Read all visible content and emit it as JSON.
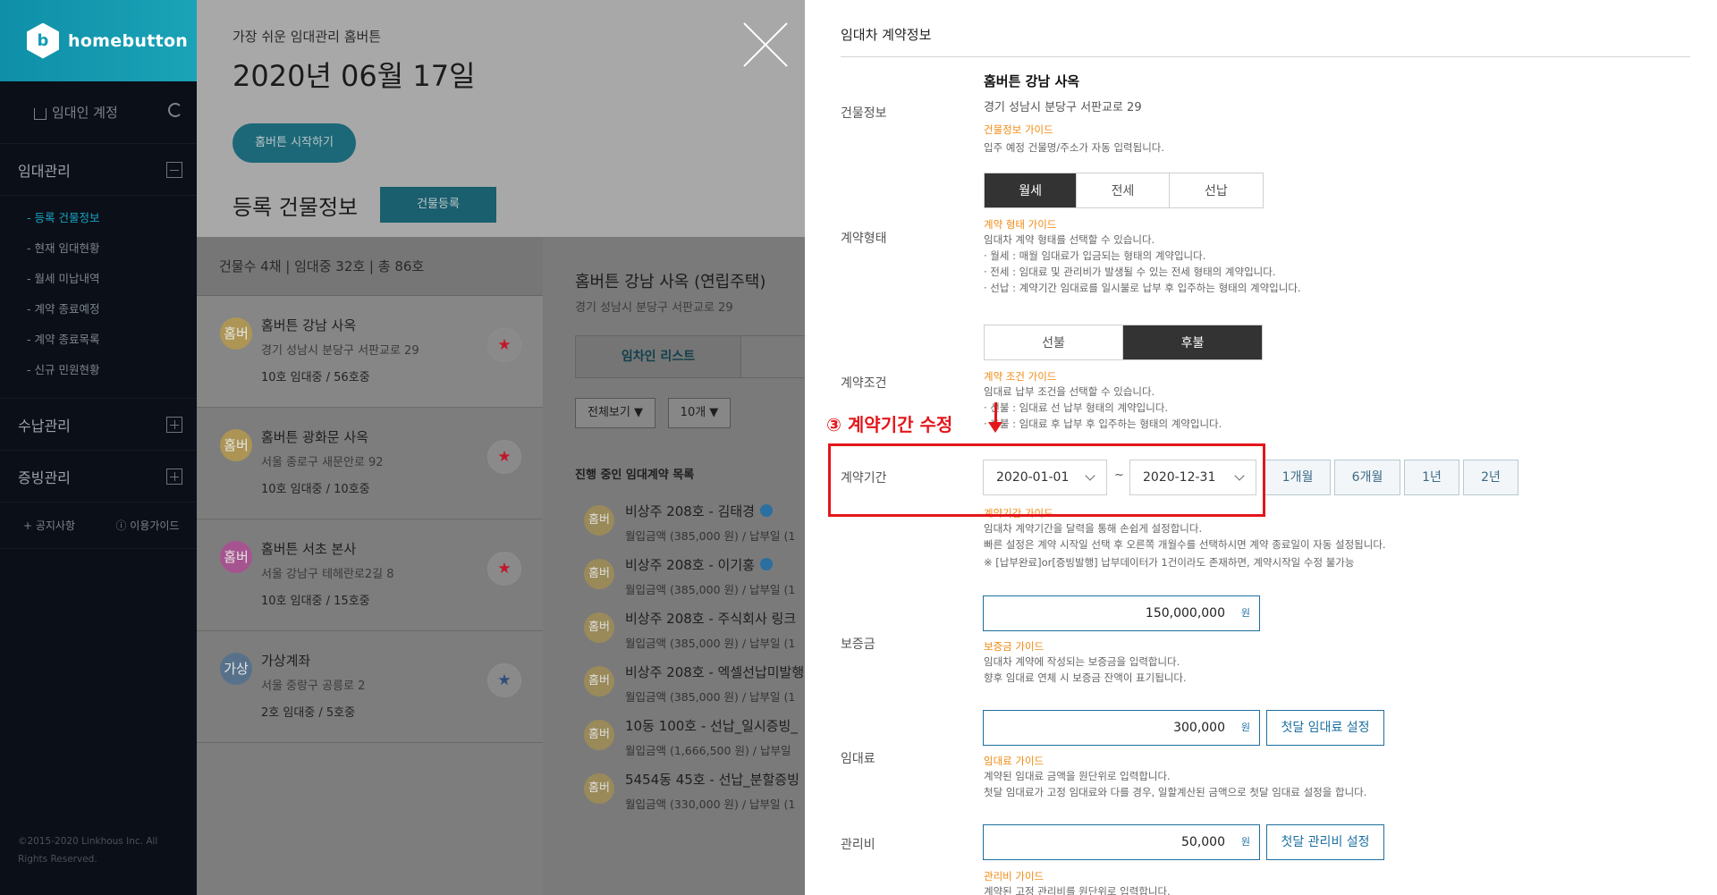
{
  "sidebar": {
    "brand": "homebutton",
    "account": "임대인 계정",
    "menu1": "임대관리",
    "submenu": [
      "- 등록 건물정보",
      "- 현재 임대현황",
      "- 월세 미납내역",
      "- 계약 종료예정",
      "- 계약 종료목록",
      "- 신규 민원현황"
    ],
    "menu2": "수납관리",
    "menu3": "증빙관리",
    "notice": "+ 공지사항",
    "guide": "ⓘ 이용가이드",
    "copyright": "©2015-2020 Linkhous Inc. All Rights Reserved."
  },
  "hero": {
    "subtitle": "가장 쉬운 임대관리 홈버튼",
    "date": "2020년 06월 17일",
    "start_button": "홈버튼 시작하기",
    "reg_title": "등록 건물정보",
    "reg_button": "건물등록"
  },
  "stats": "건물수 4채  |  임대중 32호  |  총 86호",
  "buildings": [
    {
      "avatar": "홈버",
      "color": "#b79a4a",
      "name": "홈버튼 강남 사옥",
      "addr": "경기 성남시 분당구 서판교로 29",
      "units": "10호 임대중 / 56호중",
      "star": "★",
      "star_color": "#c0182a"
    },
    {
      "avatar": "홈버",
      "color": "#b79a4a",
      "name": "홈버튼 광화문 사옥",
      "addr": "서울 종로구 새문안로 92",
      "units": "10호 임대중 / 10호중",
      "star": "★",
      "star_color": "#c0182a"
    },
    {
      "avatar": "홈버",
      "color": "#b04a94",
      "name": "홈버튼 서초 본사",
      "addr": "서울 강남구 테헤란로2길 8",
      "units": "10호 임대중 / 15호중",
      "star": "★",
      "star_color": "#c0182a"
    },
    {
      "avatar": "가상",
      "color": "#4e6f8e",
      "name": "가상계좌",
      "addr": "서울 중랑구 공릉로 2",
      "units": "2호 임대중 / 5호중",
      "star": "★",
      "star_color": "#2f4f7a"
    }
  ],
  "detail": {
    "title": "홈버튼 강남 사옥 (연립주택)",
    "addr": "경기 성남시 분당구 서판교로 29",
    "tab": "임차인 리스트",
    "filter1": "전체보기 ▼",
    "filter2": "10개 ▼",
    "list_title": "진행 중인 임대계약 목록",
    "contracts": [
      {
        "avatar": "홈버",
        "title": "비상주 208호 - 김태경",
        "sub": "월입금액 (385,000 원) / 납부일 (1"
      },
      {
        "avatar": "홈버",
        "title": "비상주 208호 - 이기홍",
        "sub": "월입금액 (385,000 원) / 납부일 (1"
      },
      {
        "avatar": "홈버",
        "title": "비상주 208호 - 주식회사 링크",
        "sub": "월입금액 (385,000 원) / 납부일 (1"
      },
      {
        "avatar": "홈버",
        "title": "비상주 208호 - 엑셀선납미발행",
        "sub": "월입금액 (385,000 원) / 납부일 (1"
      },
      {
        "avatar": "홈버",
        "title": "10동 100호 - 선납_일시증빙_",
        "sub": "월입금액 (1,666,500 원) / 납부일"
      },
      {
        "avatar": "홈버",
        "title": "5454동 45호 - 선납_분할증빙",
        "sub": "월입금액 (330,000 원) / 납부일 (1"
      }
    ]
  },
  "drawer": {
    "title": "임대차 계약정보",
    "building": {
      "label": "건물정보",
      "name": "홈버튼 강남 사옥",
      "addr": "경기 성남시 분당구 서판교로 29",
      "guide": "건물정보 가이드",
      "desc": "입주 예정 건물명/주소가 자동 입력됩니다."
    },
    "type": {
      "label": "계약형태",
      "options": [
        "월세",
        "전세",
        "선납"
      ],
      "selected": "월세",
      "guide": "계약 형태 가이드",
      "desc": [
        "임대차 계약 형태를 선택할 수 있습니다.",
        "·  월세 : 매월 임대료가 입금되는 형태의 계약입니다.",
        "·  전세 : 임대료 및 관리비가 발생될 수 있는 전세 형태의 계약입니다.",
        "·  선납 : 계약기간 임대료를 일시불로 납부 후 입주하는 형태의 계약입니다."
      ]
    },
    "condition": {
      "label": "계약조건",
      "options": [
        "선불",
        "후불"
      ],
      "selected": "후불",
      "guide": "계약 조건 가이드",
      "desc": [
        "임대료 납부 조건을 선택할 수 있습니다.",
        "·  선불 : 임대료 선 납부 형태의 계약입니다.",
        "·  후불 : 임대료 후 납부 후 입주하는 형태의 계약입니다."
      ]
    },
    "period": {
      "label": "계약기간",
      "start": "2020-01-01",
      "end": "2020-12-31",
      "tilde": "~",
      "quick": [
        "1개월",
        "6개월",
        "1년",
        "2년"
      ],
      "guide": "계약기간 가이드",
      "desc": [
        "임대차 계약기간을 달력을 통해 손쉽게 설정합니다.",
        "빠른 설정은 계약 시작일 선택 후 오른쪽 개월수를 선택하시면 계약 종료일이 자동 설정됩니다.",
        "※ [납부완료]or[증빙발행] 납부데이터가 1건이라도 존재하면, 계약시작일 수정 불가능"
      ]
    },
    "deposit": {
      "label": "보증금",
      "value": "150,000,000",
      "unit": "원",
      "guide": "보증금 가이드",
      "desc": [
        "임대차 계약에 작성되는 보증금을 입력합니다.",
        "향후 임대료 연체 시 보증금 잔액이 표기됩니다."
      ]
    },
    "rent": {
      "label": "임대료",
      "value": "300,000",
      "unit": "원",
      "first_button": "첫달 임대료 설정",
      "guide": "임대료 가이드",
      "desc": [
        "계약된 임대료 금액을 원단위로 입력합니다.",
        "첫달 임대료가 고정 임대료와 다를 경우, 일할계산된 금액으로 첫달 임대료 설정을 합니다."
      ]
    },
    "fee": {
      "label": "관리비",
      "value": "50,000",
      "unit": "원",
      "first_button": "첫달 관리비 설정",
      "guide": "관리비 가이드",
      "desc": [
        "계약된 고정 관리비를 원단위로 입력합니다."
      ]
    }
  },
  "annotation": {
    "text": "③ 계약기간 수정",
    "color": "#e3161b"
  }
}
